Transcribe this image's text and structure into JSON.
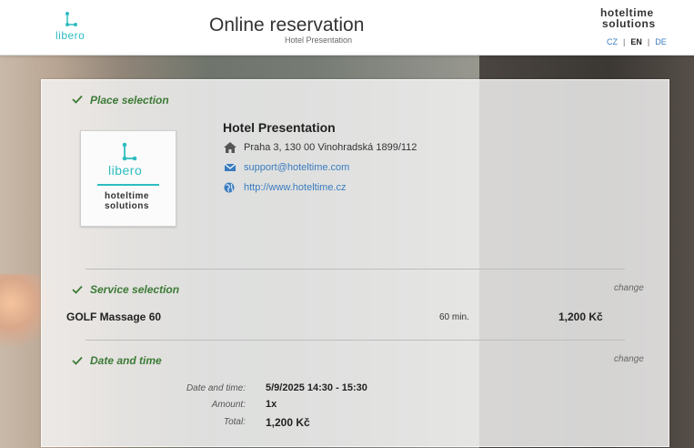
{
  "header": {
    "brand_logo_text": "libero",
    "title": "Online reservation",
    "subtitle": "Hotel Presentation",
    "vendor_logo_line1": "hoteltime",
    "vendor_logo_line2": "solutions",
    "languages": [
      "CZ",
      "EN",
      "DE"
    ],
    "active_language": "EN"
  },
  "place": {
    "section_title": "Place selection",
    "hotel_name": "Hotel Presentation",
    "address": "Praha 3, 130 00 Vinohradská 1899/112",
    "email": "support@hoteltime.com",
    "website": "http://www.hoteltime.cz",
    "logo_text": "libero",
    "logo_vendor_line1": "hoteltime",
    "logo_vendor_line2": "solutions"
  },
  "service": {
    "section_title": "Service selection",
    "change_label": "change",
    "name": "GOLF Massage 60",
    "duration": "60 min.",
    "price": "1,200 Kč"
  },
  "datetime": {
    "section_title": "Date and time",
    "change_label": "change",
    "rows": [
      {
        "label": "Date and time:",
        "value": "5/9/2025  14:30 - 15:30"
      },
      {
        "label": "Amount:",
        "value": "1x"
      },
      {
        "label": "Total:",
        "value": "1,200 Kč"
      }
    ]
  },
  "colors": {
    "accent_green": "#3c7a36",
    "brand_teal": "#2ebdc0",
    "link_blue": "#3a7bbf"
  },
  "icons": [
    "check-icon",
    "home-icon",
    "envelope-icon",
    "globe-icon"
  ]
}
